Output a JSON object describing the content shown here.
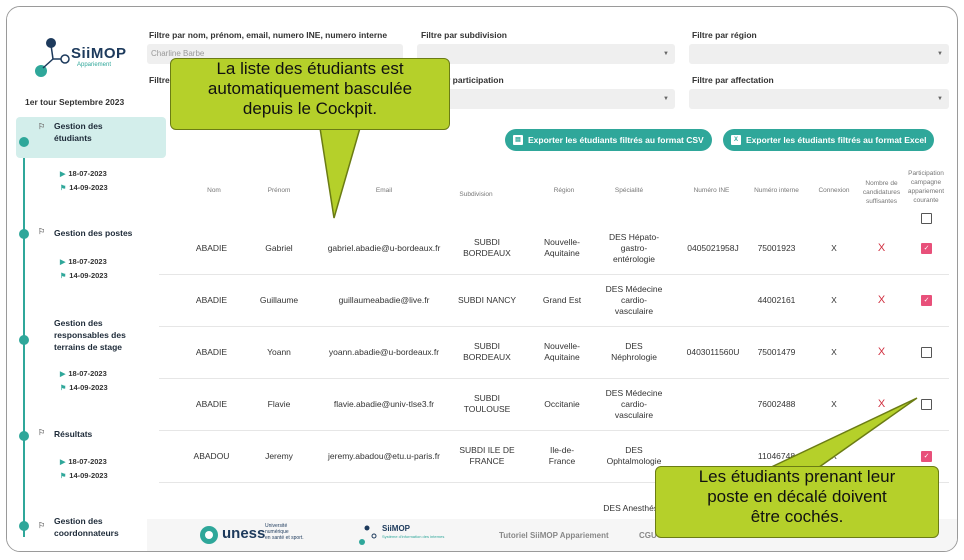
{
  "app": {
    "logo_text": "SiiMOP",
    "logo_sub": "Appariement",
    "round": "1er tour Septembre 2023"
  },
  "sidebar": {
    "steps": [
      {
        "label_line1": "Gestion des",
        "label_line2": "étudiants",
        "dates": [
          "18-07-2023",
          "14-09-2023"
        ],
        "active": true
      },
      {
        "label_line1": "Gestion des postes",
        "label_line2": "",
        "dates": [
          "18-07-2023",
          "14-09-2023"
        ]
      },
      {
        "label_line1": "Gestion des",
        "label_line2": "responsables des",
        "label_line3": "terrains de stage",
        "dates": [
          "18-07-2023",
          "14-09-2023"
        ]
      },
      {
        "label_line1": "Résultats",
        "label_line2": "",
        "dates": [
          "18-07-2023",
          "14-09-2023"
        ]
      },
      {
        "label_line1": "Gestion des",
        "label_line2": "coordonnateurs",
        "dates": []
      }
    ]
  },
  "filters": {
    "name_label": "Filtre par nom, prénom, email, numero INE, numero interne",
    "name_value": "Charline Barbe",
    "subdivision_label": "Filtre par subdivision",
    "region_label": "Filtre par région",
    "participation_label": "Filtre par participation",
    "participation_label_visible": "r participation",
    "affectation_label": "Filtre par affectation",
    "second_row_prefix": "Filtre"
  },
  "buttons": {
    "csv": "Exporter les étudiants filtrés au format CSV",
    "excel": "Exporter les étudiants filtrés au format Excel"
  },
  "table": {
    "headers": {
      "nom": "Nom",
      "prenom": "Prénom",
      "email": "Email",
      "subdivision": "Subdivision",
      "region": "Région",
      "specialite": "Spécialité",
      "ine": "Numéro INE",
      "interne": "Numéro interne",
      "connexion": "Connexion",
      "candidatures_l1": "Nombre de",
      "candidatures_l2": "candidatures",
      "candidatures_l3": "suffisantes",
      "participation_l1": "Participation",
      "participation_l2": "campagne",
      "participation_l3": "appariement",
      "participation_l4": "courante"
    },
    "rows": [
      {
        "nom": "ABADIE",
        "prenom": "Gabriel",
        "email": "gabriel.abadie@u-bordeaux.fr",
        "sub1": "SUBDI",
        "sub2": "BORDEAUX",
        "reg1": "Nouvelle-",
        "reg2": "Aquitaine",
        "sp1": "DES Hépato-",
        "sp2": "gastro-",
        "sp3": "entérologie",
        "ine": "0405021958J",
        "interne": "75001923",
        "connexion": "X",
        "cand": "X",
        "checked": true
      },
      {
        "nom": "ABADIE",
        "prenom": "Guillaume",
        "email": "guillaumeabadie@live.fr",
        "sub1": "SUBDI NANCY",
        "sub2": "",
        "reg1": "Grand Est",
        "reg2": "",
        "sp1": "DES Médecine",
        "sp2": "cardio-",
        "sp3": "vasculaire",
        "ine": "",
        "interne": "44002161",
        "connexion": "X",
        "cand": "X",
        "checked": true
      },
      {
        "nom": "ABADIE",
        "prenom": "Yoann",
        "email": "yoann.abadie@u-bordeaux.fr",
        "sub1": "SUBDI",
        "sub2": "BORDEAUX",
        "reg1": "Nouvelle-",
        "reg2": "Aquitaine",
        "sp1": "DES",
        "sp2": "Néphrologie",
        "sp3": "",
        "ine": "0403011560U",
        "interne": "75001479",
        "connexion": "X",
        "cand": "X",
        "checked": false
      },
      {
        "nom": "ABADIE",
        "prenom": "Flavie",
        "email": "flavie.abadie@univ-tlse3.fr",
        "sub1": "SUBDI",
        "sub2": "TOULOUSE",
        "reg1": "Occitanie",
        "reg2": "",
        "sp1": "DES Médecine",
        "sp2": "cardio-",
        "sp3": "vasculaire",
        "ine": "",
        "interne": "76002488",
        "connexion": "X",
        "cand": "X",
        "checked": false
      },
      {
        "nom": "ABADOU",
        "prenom": "Jeremy",
        "email": "jeremy.abadou@etu.u-paris.fr",
        "sub1": "SUBDI ILE DE",
        "sub2": "FRANCE",
        "reg1": "Ile-de-",
        "reg2": "France",
        "sp1": "DES",
        "sp2": "Ophtalmologie",
        "sp3": "",
        "ine": "",
        "interne": "11046748",
        "connexion": "X",
        "cand": "",
        "checked": true
      },
      {
        "nom": "",
        "prenom": "",
        "email": "",
        "sub1": "",
        "sub2": "",
        "reg1": "",
        "reg2": "",
        "sp1": "DES Anesthésie",
        "sp2": "",
        "sp3": "",
        "ine": "",
        "interne": "",
        "connexion": "",
        "cand": "",
        "checked": false
      }
    ]
  },
  "footer": {
    "uness_main": "uness",
    "uness_sub1": "Université",
    "uness_sub2": "numérique",
    "uness_sub3": "en santé et sport.",
    "siimop_logo": "SiiMOP",
    "siimop_sub": "Système d'information des internes",
    "tutorial": "Tutoriel SiiMOP Appariement",
    "cgu": "CGU"
  },
  "callouts": {
    "top": [
      "La liste des étudiants est",
      "automatiquement basculée",
      "depuis le Cockpit."
    ],
    "bottom": [
      "Les étudiants prenant leur",
      "poste en décalé doivent",
      "être cochés."
    ]
  },
  "colors": {
    "accent": "#2fa79a",
    "checkbox_on": "#e8507a",
    "red_x": "#d03040",
    "callout": "#b5d02a"
  }
}
